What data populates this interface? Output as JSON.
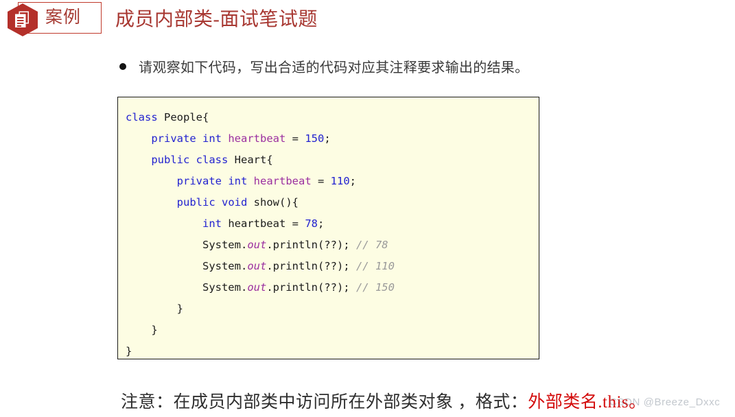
{
  "header": {
    "badge_icon": "document-stack-hexagon-icon",
    "badge_label": "案例",
    "title": "成员内部类-面试笔试题",
    "title_color": "#a83832",
    "badge_border_color": "#c0392b",
    "hex_color": "#b4302a"
  },
  "bullet": {
    "marker": "filled-circle",
    "text": "请观察如下代码，写出合适的代码对应其注释要求输出的结果。"
  },
  "code": {
    "background_color": "#fdfde3",
    "border_color": "#1a1a1a",
    "language": "java",
    "lines": [
      [
        {
          "t": "class",
          "c": "kw"
        },
        {
          "t": " People{",
          "c": "plain"
        }
      ],
      [
        {
          "t": "    ",
          "c": "plain"
        },
        {
          "t": "private",
          "c": "kw"
        },
        {
          "t": " ",
          "c": "plain"
        },
        {
          "t": "int",
          "c": "kw"
        },
        {
          "t": " ",
          "c": "plain"
        },
        {
          "t": "heartbeat",
          "c": "fld"
        },
        {
          "t": " = ",
          "c": "plain"
        },
        {
          "t": "150",
          "c": "num"
        },
        {
          "t": ";",
          "c": "plain"
        }
      ],
      [
        {
          "t": "    ",
          "c": "plain"
        },
        {
          "t": "public",
          "c": "kw"
        },
        {
          "t": " ",
          "c": "plain"
        },
        {
          "t": "class",
          "c": "kw"
        },
        {
          "t": " Heart{",
          "c": "plain"
        }
      ],
      [
        {
          "t": "        ",
          "c": "plain"
        },
        {
          "t": "private",
          "c": "kw"
        },
        {
          "t": " ",
          "c": "plain"
        },
        {
          "t": "int",
          "c": "kw"
        },
        {
          "t": " ",
          "c": "plain"
        },
        {
          "t": "heartbeat",
          "c": "fld"
        },
        {
          "t": " = ",
          "c": "plain"
        },
        {
          "t": "110",
          "c": "num"
        },
        {
          "t": ";",
          "c": "plain"
        }
      ],
      [
        {
          "t": "        ",
          "c": "plain"
        },
        {
          "t": "public",
          "c": "kw"
        },
        {
          "t": " ",
          "c": "plain"
        },
        {
          "t": "void",
          "c": "kw"
        },
        {
          "t": " show(){",
          "c": "plain"
        }
      ],
      [
        {
          "t": "            ",
          "c": "plain"
        },
        {
          "t": "int",
          "c": "kw"
        },
        {
          "t": " heartbeat = ",
          "c": "plain"
        },
        {
          "t": "78",
          "c": "num"
        },
        {
          "t": ";",
          "c": "plain"
        }
      ],
      [
        {
          "t": "            System.",
          "c": "plain"
        },
        {
          "t": "out",
          "c": "sfld"
        },
        {
          "t": ".println(??); ",
          "c": "plain"
        },
        {
          "t": "// 78",
          "c": "cmt"
        }
      ],
      [
        {
          "t": "            System.",
          "c": "plain"
        },
        {
          "t": "out",
          "c": "sfld"
        },
        {
          "t": ".println(??); ",
          "c": "plain"
        },
        {
          "t": "// 110",
          "c": "cmt"
        }
      ],
      [
        {
          "t": "            System.",
          "c": "plain"
        },
        {
          "t": "out",
          "c": "sfld"
        },
        {
          "t": ".println(??); ",
          "c": "plain"
        },
        {
          "t": "// 150",
          "c": "cmt"
        }
      ],
      [
        {
          "t": "        }",
          "c": "plain"
        }
      ],
      [
        {
          "t": "    }",
          "c": "plain"
        }
      ],
      [
        {
          "t": "}",
          "c": "plain"
        }
      ]
    ]
  },
  "note": {
    "prefix": "注意：在成员内部类中访问所在外部类对象 ，格式：",
    "highlight": "外部类名.this。",
    "highlight_color": "#d30b0b"
  },
  "watermark": {
    "text": "CSDN @Breeze_Dxxc"
  }
}
